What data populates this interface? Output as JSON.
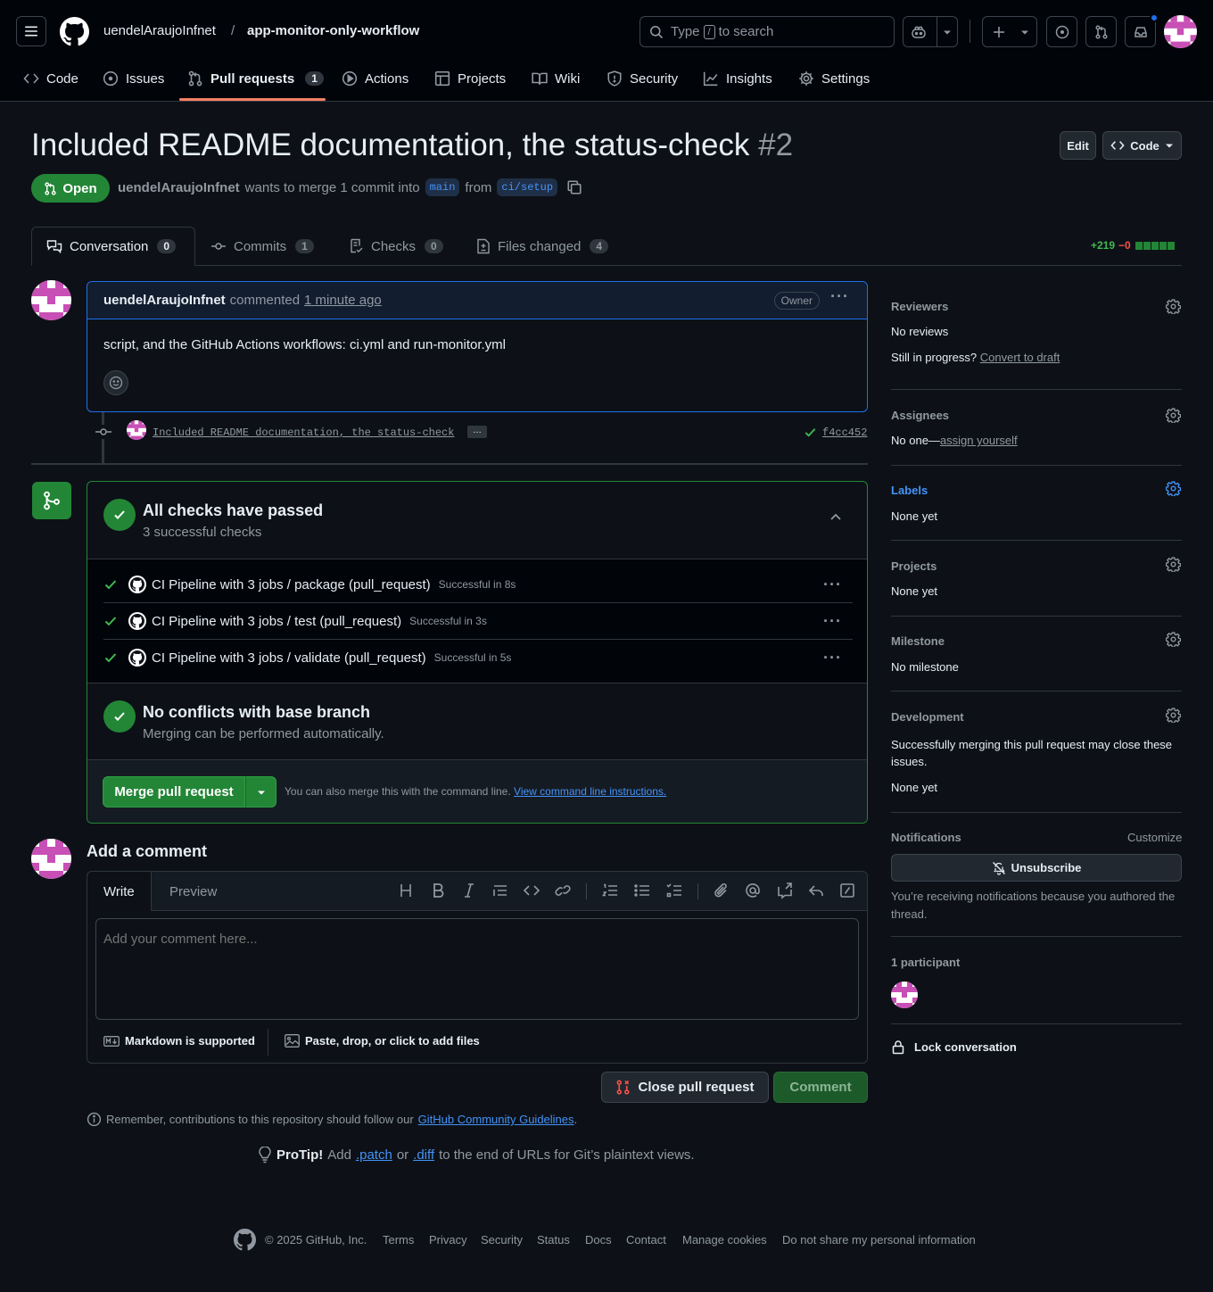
{
  "header": {
    "owner": "uendelAraujoInfnet",
    "separator": "/",
    "repo": "app-monitor-only-workflow",
    "search_prefix": "Type",
    "search_key": "/",
    "search_suffix": "to search"
  },
  "repo_nav": [
    {
      "label": "Code",
      "icon": "code-icon"
    },
    {
      "label": "Issues",
      "icon": "issue-icon"
    },
    {
      "label": "Pull requests",
      "icon": "pull-request-icon",
      "count": "1"
    },
    {
      "label": "Actions",
      "icon": "play-icon"
    },
    {
      "label": "Projects",
      "icon": "table-icon"
    },
    {
      "label": "Wiki",
      "icon": "book-icon"
    },
    {
      "label": "Security",
      "icon": "shield-icon"
    },
    {
      "label": "Insights",
      "icon": "graph-icon"
    },
    {
      "label": "Settings",
      "icon": "gear-icon"
    }
  ],
  "pr": {
    "title": "Included README documentation, the status-check",
    "number": "#2",
    "state": "Open",
    "author": "uendelAraujoInfnet",
    "merge_text": "wants to merge 1 commit into",
    "base": "main",
    "from_text": "from",
    "head": "ci/setup",
    "edit_label": "Edit",
    "code_label": "Code"
  },
  "tabs": [
    {
      "label": "Conversation",
      "count": "0"
    },
    {
      "label": "Commits",
      "count": "1"
    },
    {
      "label": "Checks",
      "count": "0"
    },
    {
      "label": "Files changed",
      "count": "4"
    }
  ],
  "diffstat": {
    "additions": "+219",
    "deletions": "−0"
  },
  "comment": {
    "author": "uendelAraujoInfnet",
    "action": "commented",
    "time": "1 minute ago",
    "role": "Owner",
    "body": "script, and the GitHub Actions workflows: ci.yml and run-monitor.yml"
  },
  "commit": {
    "message": "Included README documentation, the status-check",
    "ellipsis": "…",
    "sha": "f4cc452"
  },
  "checks": {
    "title": "All checks have passed",
    "subtitle": "3 successful checks",
    "items": [
      {
        "name": "CI Pipeline with 3 jobs / package (pull_request)",
        "duration": "Successful in 8s"
      },
      {
        "name": "CI Pipeline with 3 jobs / test (pull_request)",
        "duration": "Successful in 3s"
      },
      {
        "name": "CI Pipeline with 3 jobs / validate (pull_request)",
        "duration": "Successful in 5s"
      }
    ],
    "conflicts_title": "No conflicts with base branch",
    "conflicts_sub": "Merging can be performed automatically.",
    "merge_button": "Merge pull request",
    "cli_text": "You can also merge this with the command line.",
    "cli_link": "View command line instructions."
  },
  "add_comment": {
    "heading": "Add a comment",
    "write_tab": "Write",
    "preview_tab": "Preview",
    "placeholder": "Add your comment here...",
    "markdown": "Markdown is supported",
    "attach": "Paste, drop, or click to add files",
    "close_button": "Close pull request",
    "comment_button": "Comment",
    "guidelines_prefix": "Remember, contributions to this repository should follow our",
    "guidelines_link": "GitHub Community Guidelines",
    "guidelines_suffix": "."
  },
  "protip": {
    "label": "ProTip!",
    "text1": "Add",
    "patch": ".patch",
    "text2": "or",
    "diff": ".diff",
    "text3": "to the end of URLs for Git’s plaintext views."
  },
  "sidebar": {
    "reviewers": "Reviewers",
    "reviewers_value": "No reviews",
    "draft_prefix": "Still in progress?",
    "draft_link": "Convert to draft",
    "assignees": "Assignees",
    "assignees_prefix": "No one—",
    "assignees_link": "assign yourself",
    "labels": "Labels",
    "labels_value": "None yet",
    "projects": "Projects",
    "projects_value": "None yet",
    "milestone": "Milestone",
    "milestone_value": "No milestone",
    "development": "Development",
    "development_text": "Successfully merging this pull request may close these issues.",
    "development_value": "None yet",
    "notifications": "Notifications",
    "customize": "Customize",
    "unsubscribe": "Unsubscribe",
    "notifications_reason": "You’re receiving notifications because you authored the thread.",
    "participants": "1 participant",
    "lock": "Lock conversation"
  },
  "footer": {
    "copyright": "© 2025 GitHub, Inc.",
    "links": [
      "Terms",
      "Privacy",
      "Security",
      "Status",
      "Docs",
      "Contact",
      "Manage cookies",
      "Do not share my personal information"
    ]
  },
  "colors": {
    "accent": "#4493f8",
    "success": "#238636",
    "danger": "#f85149"
  }
}
